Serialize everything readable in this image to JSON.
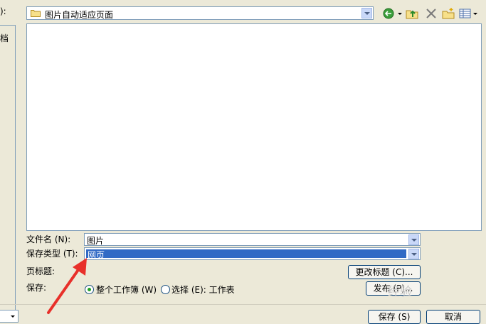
{
  "dialog": {
    "left_label_fragment": "):",
    "sidebar_fragment": "档",
    "location": {
      "folder": "图片自动适应页面"
    },
    "file_name": {
      "label": "文件名 (N):",
      "value": "图片"
    },
    "save_type": {
      "label": "保存类型 (T):",
      "value": "网页"
    },
    "page_title": {
      "label": "页标题:",
      "change_button": "更改标题 (C)..."
    },
    "save": {
      "label": "保存:",
      "option_workbook": "整个工作簿 (W)",
      "option_selection": "选择 (E): 工作表",
      "selected": "option_workbook",
      "publish_button": "发布 (P)..."
    },
    "buttons": {
      "save": "保存 (S)",
      "cancel": "取消"
    },
    "watermark": "经验"
  },
  "icons": [
    "folder-icon",
    "back-icon",
    "up-folder-icon",
    "delete-icon",
    "new-folder-icon",
    "views-icon"
  ],
  "colors": {
    "selection": "#316ac5",
    "annotation_arrow": "#e8302a"
  }
}
